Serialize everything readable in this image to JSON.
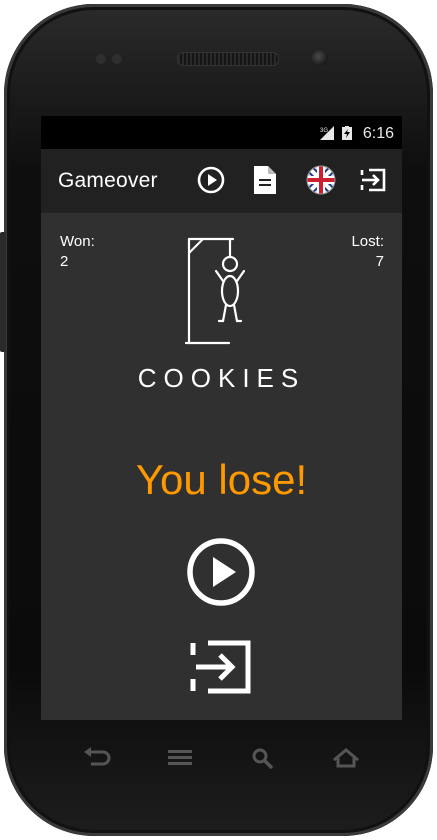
{
  "status_bar": {
    "network": "3G",
    "time": "6:16"
  },
  "action_bar": {
    "title": "Gameover",
    "actions": [
      "play-icon",
      "document-icon",
      "uk-flag-globe-icon",
      "exit-icon"
    ]
  },
  "score": {
    "won_label": "Won:",
    "won_value": "2",
    "lost_label": "Lost:",
    "lost_value": "7"
  },
  "game": {
    "word": "COOKIES",
    "result_text": "You lose!"
  },
  "colors": {
    "accent": "#ff9900",
    "screen_bg": "#303030",
    "action_bar_bg": "#212121"
  },
  "nav": {
    "buttons": [
      "back-icon",
      "menu-icon",
      "search-icon",
      "home-icon"
    ]
  }
}
